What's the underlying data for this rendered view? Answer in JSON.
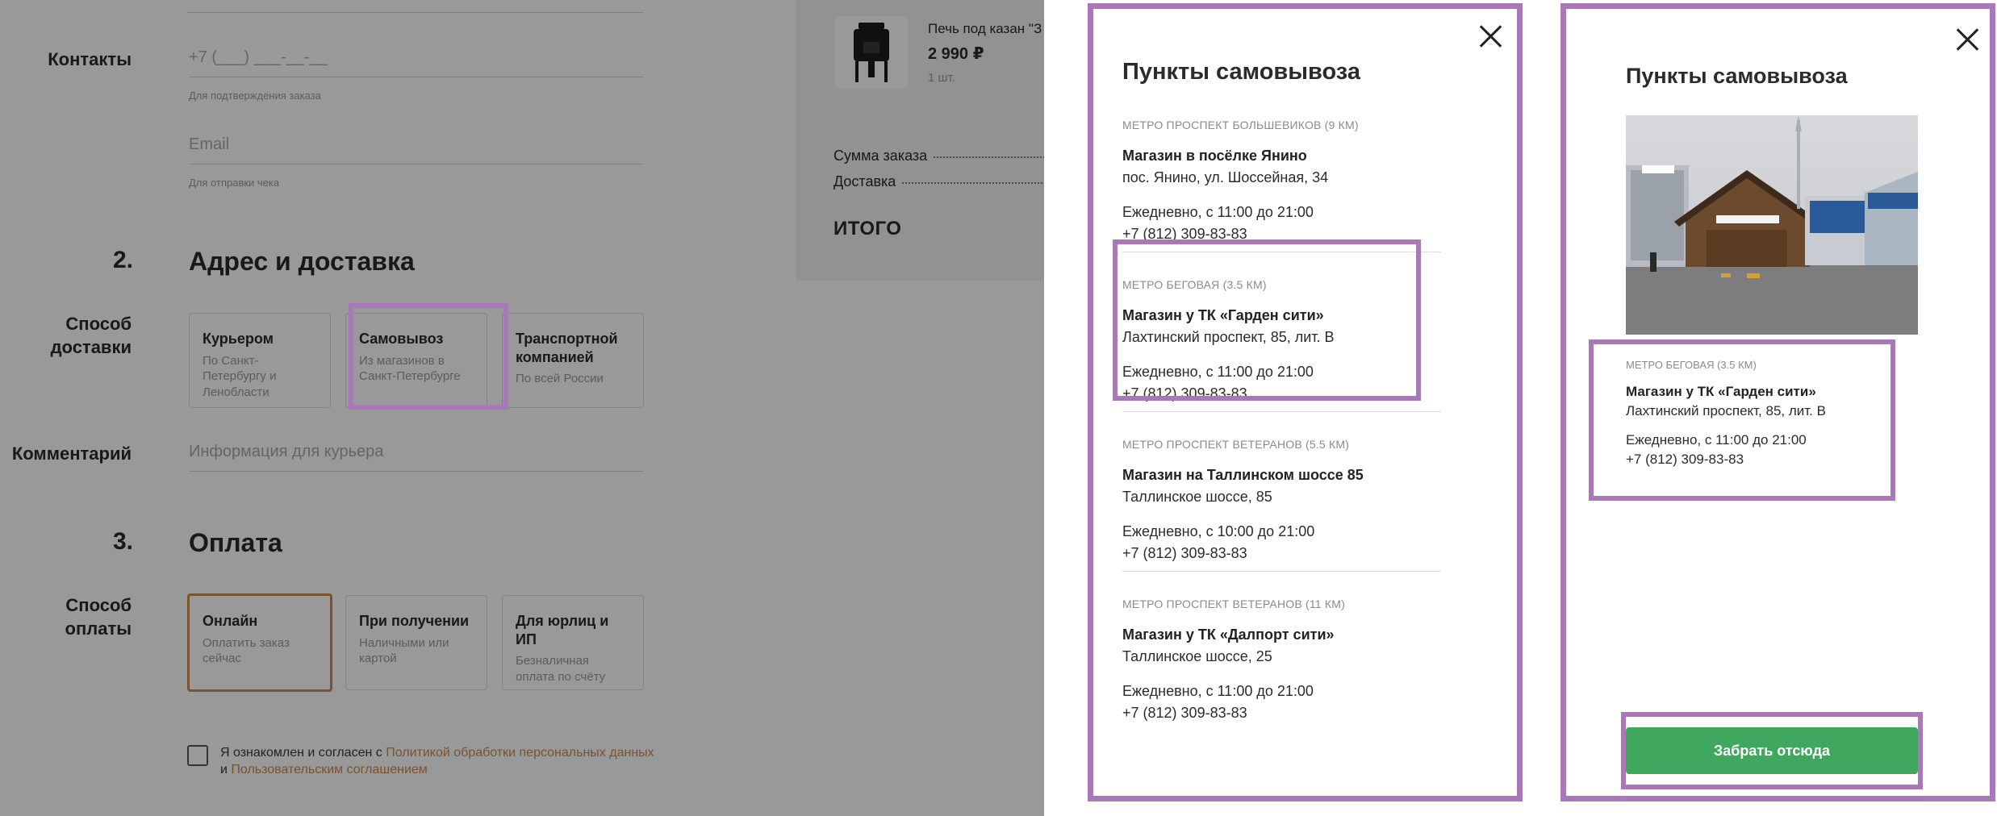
{
  "checkout": {
    "contacts_label": "Контакты",
    "phone_placeholder": "+7 (___) ___-__-__",
    "phone_hint": "Для подтверждения заказа",
    "email_placeholder": "Email",
    "email_hint": "Для отправки чека",
    "step2_number": "2.",
    "step2_title": "Адрес и доставка",
    "delivery_label": "Способ доставки",
    "delivery_options": [
      {
        "title": "Курьером",
        "subtitle": "По Санкт-Петербургу и Ленобласти"
      },
      {
        "title": "Самовывоз",
        "subtitle": "Из магазинов в Санкт-Петербурге"
      },
      {
        "title": "Транспортной компанией",
        "subtitle": "По всей России"
      }
    ],
    "comment_label": "Комментарий",
    "comment_placeholder": "Информация для курьера",
    "step3_number": "3.",
    "step3_title": "Оплата",
    "payment_label": "Способ оплаты",
    "payment_options": [
      {
        "title": "Онлайн",
        "subtitle": "Оплатить заказ сейчас"
      },
      {
        "title": "При получении",
        "subtitle": "Наличными или картой"
      },
      {
        "title": "Для юрлиц и ИП",
        "subtitle": "Безналичная оплата по счёту"
      }
    ],
    "consent_text_1": "Я ознакомлен и согласен с ",
    "consent_link_1": "Политикой обработки персональных данных",
    "consent_text_2": " и ",
    "consent_link_2": "Пользовательским соглашением"
  },
  "order_summary": {
    "product_name": "Печь под казан \"З",
    "product_price": "2 990 ₽",
    "product_qty": "1 шт.",
    "sum_label": "Сумма заказа",
    "delivery_label": "Доставка",
    "total_label": "ИТОГО"
  },
  "pickup_list": {
    "title": "Пункты самовывоза",
    "stores": [
      {
        "metro": "МЕТРО ПРОСПЕКТ БОЛЬШЕВИКОВ (9 КМ)",
        "name": "Магазин в посёлке Янино",
        "address": "пос. Янино, ул. Шоссейная, 34",
        "hours": "Ежедневно, с 11:00 до 21:00",
        "phone": "+7 (812) 309-83-83"
      },
      {
        "metro": "МЕТРО БЕГОВАЯ (3.5 КМ)",
        "name": "Магазин у ТК «Гарден сити»",
        "address": "Лахтинский проспект, 85, лит. В",
        "hours": "Ежедневно, с 11:00 до 21:00",
        "phone": "+7 (812) 309-83-83"
      },
      {
        "metro": "МЕТРО ПРОСПЕКТ ВЕТЕРАНОВ (5.5 КМ)",
        "name": "Магазин на Таллинском шоссе 85",
        "address": "Таллинское шоссе, 85",
        "hours": "Ежедневно, с 10:00 до 21:00",
        "phone": "+7 (812) 309-83-83"
      },
      {
        "metro": "МЕТРО ПРОСПЕКТ ВЕТЕРАНОВ (11 КМ)",
        "name": "Магазин у ТК «Далпорт сити»",
        "address": "Таллинское шоссе, 25",
        "hours": "Ежедневно, с 11:00 до 21:00",
        "phone": "+7 (812) 309-83-83"
      }
    ]
  },
  "pickup_detail": {
    "title": "Пункты самовывоза",
    "metro": "МЕТРО БЕГОВАЯ (3.5 КМ)",
    "name": "Магазин у ТК «Гарден сити»",
    "address": "Лахтинский проспект, 85, лит. В",
    "hours": "Ежедневно, с 11:00 до 21:00",
    "phone": "+7 (812) 309-83-83",
    "button_label": "Забрать отсюда"
  },
  "colors": {
    "accent": "#c98a4e",
    "highlight": "#a878b9",
    "button": "#40a85e"
  }
}
